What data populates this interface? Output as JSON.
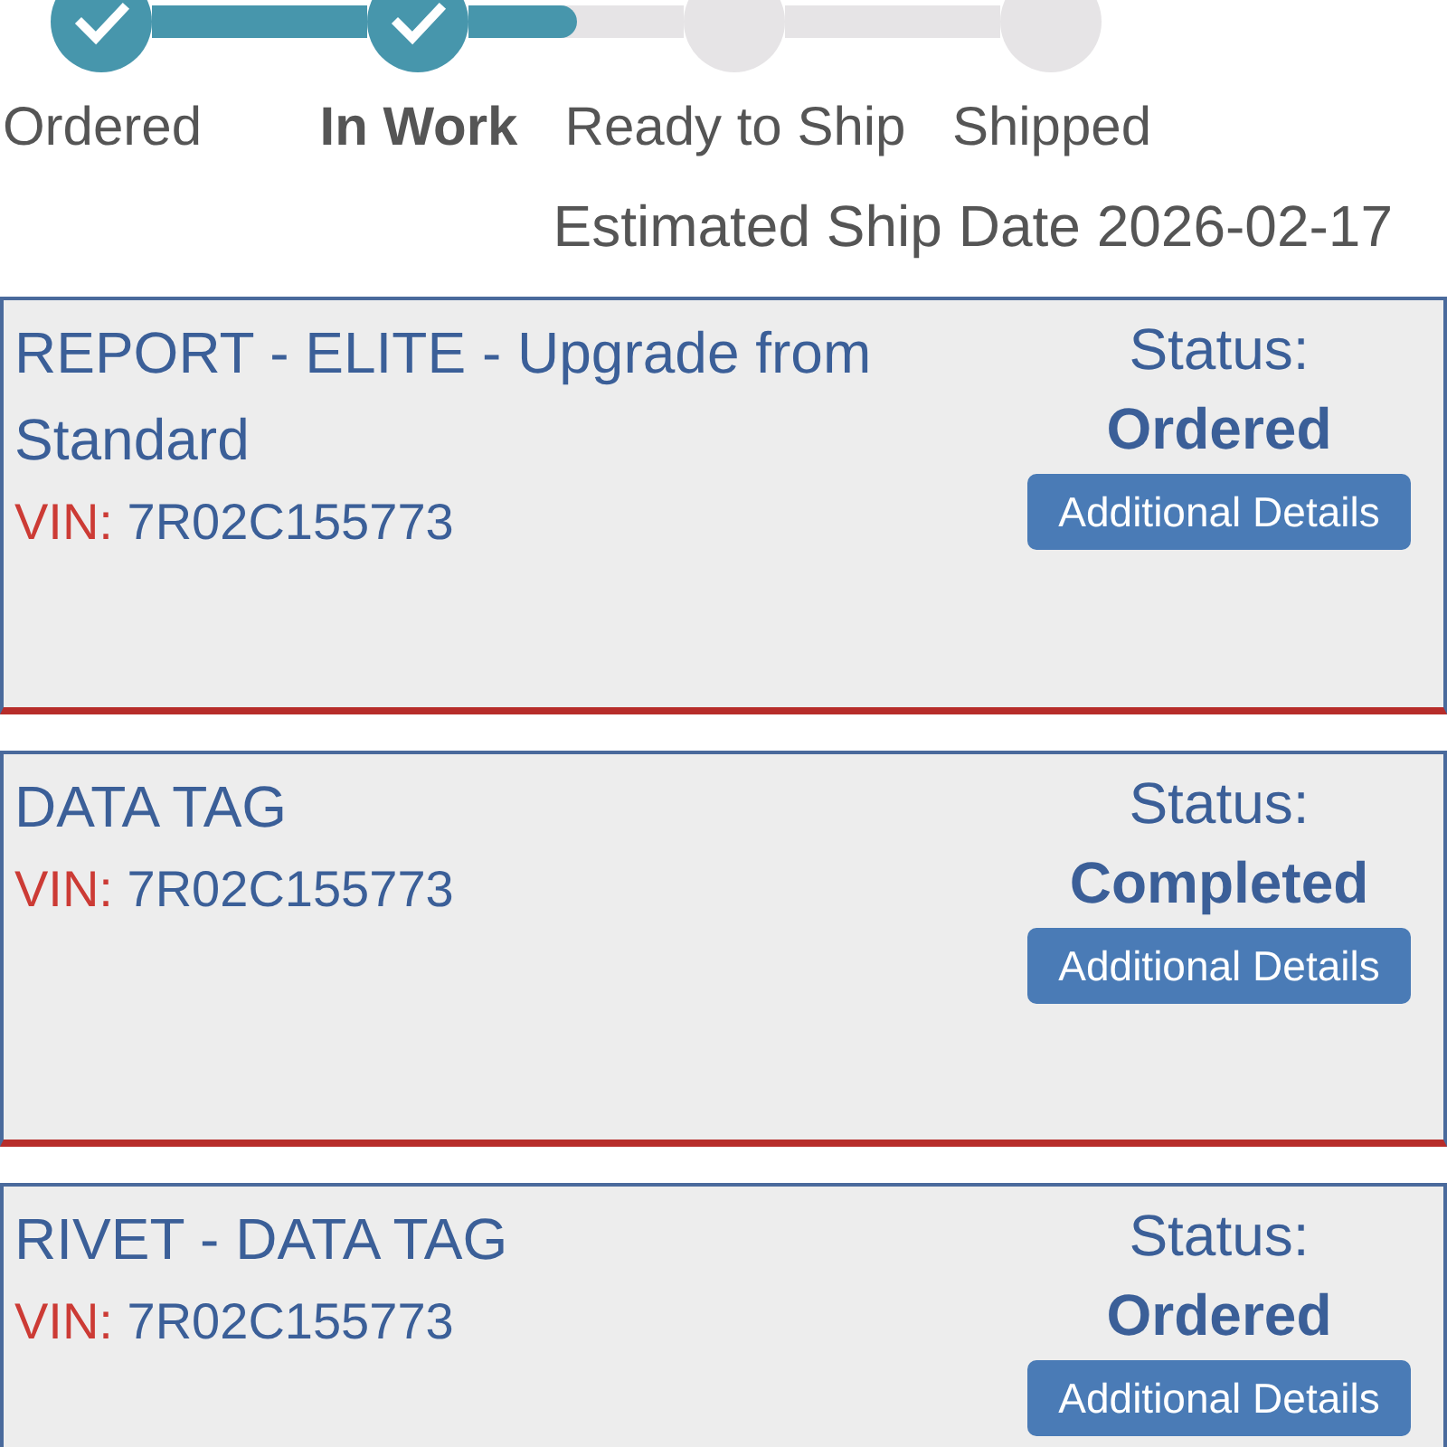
{
  "progress": {
    "steps": [
      {
        "label": "Ordered",
        "completed": true,
        "selected": false
      },
      {
        "label": "In Work",
        "completed": true,
        "selected": true
      },
      {
        "label": "Ready to Ship",
        "completed": false,
        "selected": false
      },
      {
        "label": "Shipped",
        "completed": false,
        "selected": false
      }
    ],
    "connectors": [
      {
        "kind": "complete"
      },
      {
        "kind": "partial",
        "level": 0.5
      },
      {
        "kind": "pending"
      }
    ]
  },
  "estimated_ship_date": "Estimated Ship Date 2026-02-17",
  "items": [
    {
      "title": "REPORT - ELITE - Upgrade from Standard",
      "vin_label": "VIN:",
      "vin": "7R02C155773",
      "status_label": "Status:",
      "status": "Ordered",
      "button": "Additional Details"
    },
    {
      "title": "DATA TAG",
      "vin_label": "VIN:",
      "vin": "7R02C155773",
      "status_label": "Status:",
      "status": "Completed",
      "button": "Additional Details"
    },
    {
      "title": "RIVET - DATA TAG",
      "vin_label": "VIN:",
      "vin": "7R02C155773",
      "status_label": "Status:",
      "status": "Ordered",
      "button": "Additional Details"
    }
  ]
}
